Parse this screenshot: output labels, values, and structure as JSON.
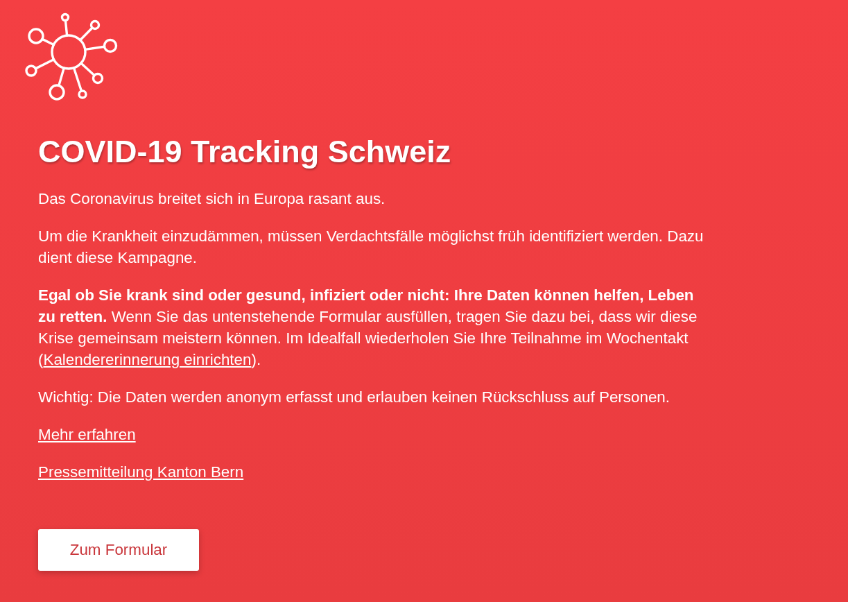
{
  "title": "COVID-19 Tracking Schweiz",
  "paragraphs": [
    {
      "segments": [
        {
          "kind": "text",
          "text": "Das Coronavirus breitet sich in Europa rasant aus."
        }
      ]
    },
    {
      "segments": [
        {
          "kind": "text",
          "text": "Um die Krankheit einzudämmen, müssen Verdachtsfälle möglichst früh identifiziert werden. Dazu dient diese Kampagne."
        }
      ]
    },
    {
      "segments": [
        {
          "kind": "text",
          "text": "**Egal ob Sie krank sind oder gesund, infiziert oder nicht: Ihre Daten können helfen, Leben zu retten.** Wenn Sie das untenstehende Formular ausfüllen, tragen Sie dazu bei, dass wir diese Krise gemeinsam meistern können. Im Idealfall wiederholen Sie Ihre Teilnahme im Wochentakt ("
        },
        {
          "kind": "link",
          "text": "Kalendererinnerung einrichten"
        },
        {
          "kind": "text",
          "text": ")."
        }
      ]
    },
    {
      "segments": [
        {
          "kind": "text",
          "text": "Wichtig: Die Daten werden anonym erfasst und erlauben keinen Rückschluss auf Personen."
        }
      ]
    }
  ],
  "links": [
    "Mehr erfahren",
    "Pressemitteilung Kanton Bern"
  ],
  "button": "Zum Formular"
}
